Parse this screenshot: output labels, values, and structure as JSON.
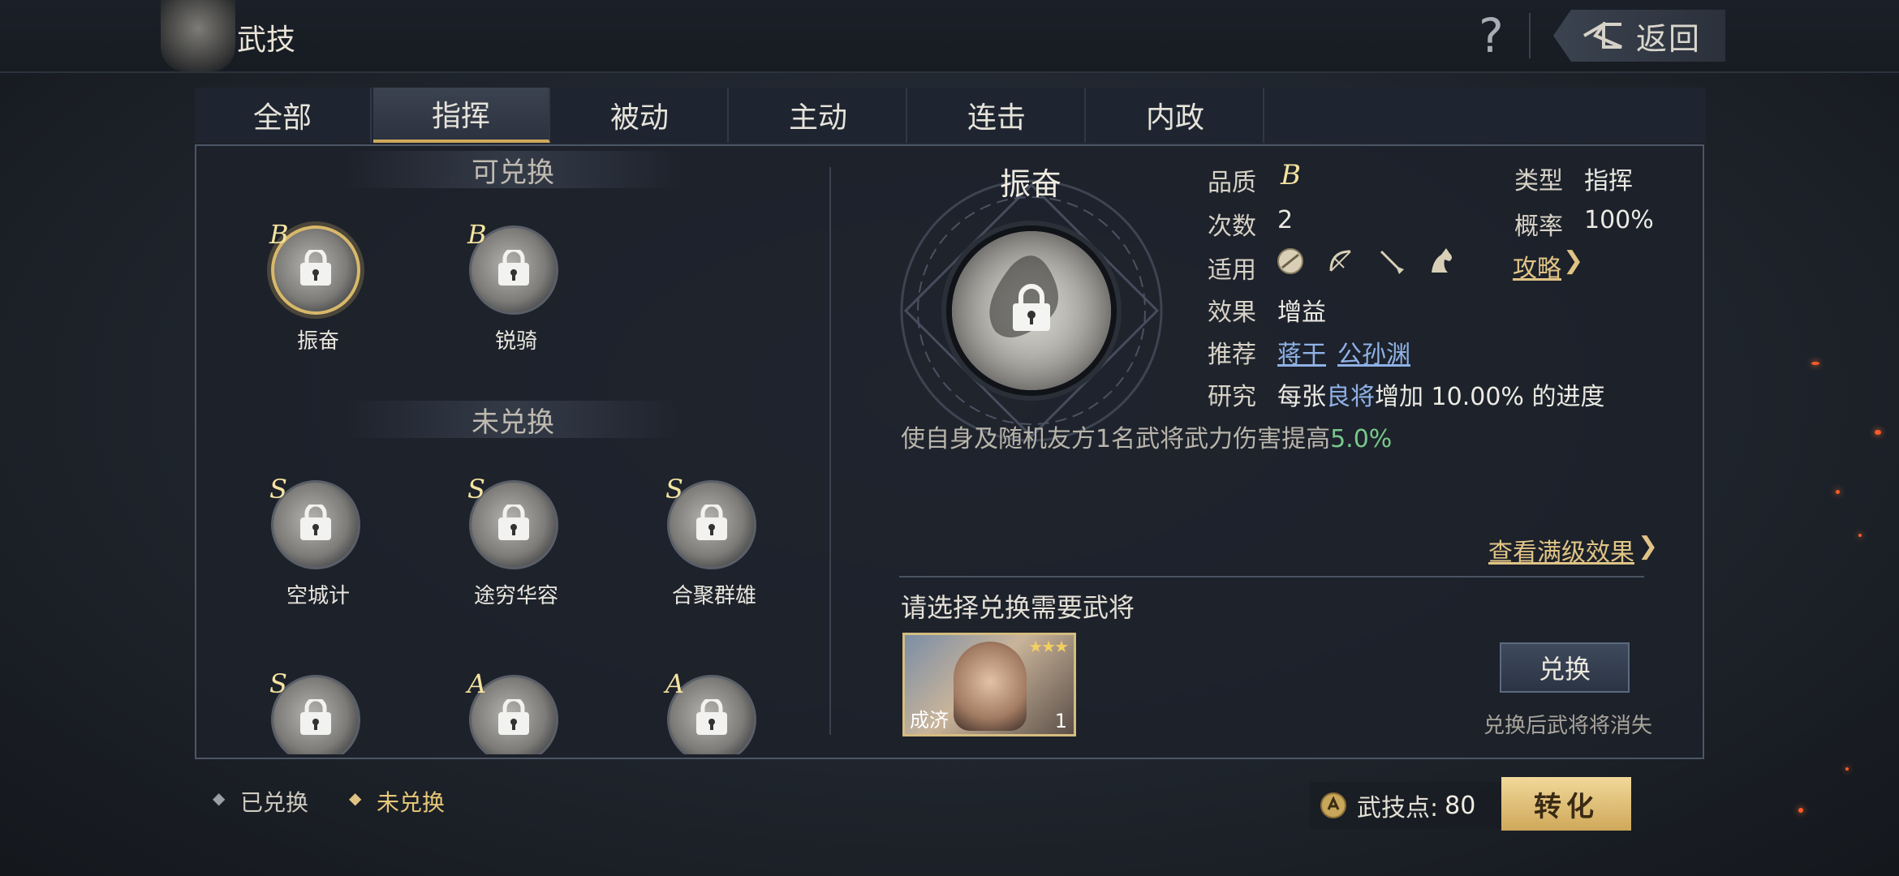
{
  "header": {
    "title": "武技",
    "help_symbol": "?",
    "back_label": "返回"
  },
  "tabs": [
    {
      "label": "全部",
      "active": false
    },
    {
      "label": "指挥",
      "active": true
    },
    {
      "label": "被动",
      "active": false
    },
    {
      "label": "主动",
      "active": false
    },
    {
      "label": "连击",
      "active": false
    },
    {
      "label": "内政",
      "active": false
    }
  ],
  "sections": {
    "exchangeable": "可兑换",
    "not_exchanged": "未兑换"
  },
  "exchangeable_skills": [
    {
      "grade": "B",
      "name": "振奋",
      "selected": true
    },
    {
      "grade": "B",
      "name": "锐骑",
      "selected": false
    }
  ],
  "not_exchanged_skills": [
    {
      "grade": "S",
      "name": "空城计"
    },
    {
      "grade": "S",
      "name": "途穷华容"
    },
    {
      "grade": "S",
      "name": "合聚群雄"
    },
    {
      "grade": "S",
      "name": ""
    },
    {
      "grade": "A",
      "name": ""
    },
    {
      "grade": "A",
      "name": ""
    }
  ],
  "detail": {
    "name": "振奋",
    "quality_label": "品质",
    "quality_value": "B",
    "type_label": "类型",
    "type_value": "指挥",
    "uses_label": "次数",
    "uses_value": "2",
    "chance_label": "概率",
    "chance_value": "100%",
    "applies_label": "适用",
    "applies_icons": [
      "shield-icon",
      "bow-icon",
      "spear-icon",
      "horse-icon"
    ],
    "guide_link": "攻略",
    "effect_label": "效果",
    "effect_value": "增益",
    "recommend_label": "推荐",
    "recommend_generals": [
      "蒋干",
      "公孙渊"
    ],
    "research_label": "研究",
    "research_prefix": "每张",
    "research_highlight": "良将",
    "research_suffix": "增加 10.00% 的进度",
    "description": "使自身及随机友方1名武将武力伤害提高",
    "description_value": "5.0%",
    "max_effect_link": "查看满级效果"
  },
  "exchange": {
    "prompt": "请选择兑换需要武将",
    "general_name": "成济",
    "general_count": "1",
    "general_stars": "★★★",
    "button_label": "兑换",
    "note": "兑换后武将将消失"
  },
  "footer": {
    "legend_exchanged": "已兑换",
    "legend_not_exchanged": "未兑换",
    "points_label": "武技点:",
    "points_value": "80",
    "convert_label": "转化"
  },
  "colors": {
    "gold": "#d8b86a",
    "accent_link": "#8fb2e6",
    "positive": "#79c88a"
  }
}
